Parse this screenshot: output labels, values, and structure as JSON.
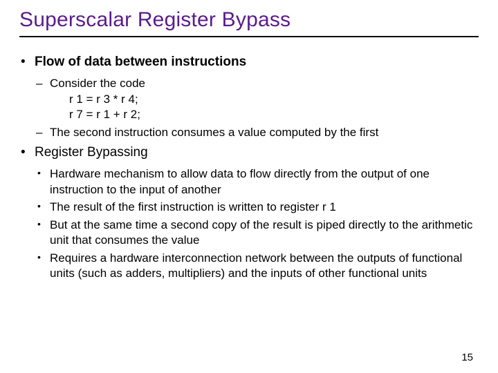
{
  "title": "Superscalar Register Bypass",
  "b1": {
    "heading": "Flow of data between instructions",
    "sub1": "Consider the code",
    "code1": "r 1 = r 3 * r 4;",
    "code2": "r 7 = r 1 + r 2;",
    "sub2": "The second instruction consumes a value computed by the first"
  },
  "b2": {
    "heading": "Register Bypassing",
    "p1": "Hardware mechanism to allow data to flow directly from the output of one instruction to the input of another",
    "p2": "The result of the first instruction is written to register r 1",
    "p3": "But at the same time a second copy of the result is piped directly to the arithmetic unit that consumes the value",
    "p4": "Requires a hardware interconnection network between the outputs of functional units (such as adders, multipliers) and the inputs of other functional units"
  },
  "page": "15"
}
